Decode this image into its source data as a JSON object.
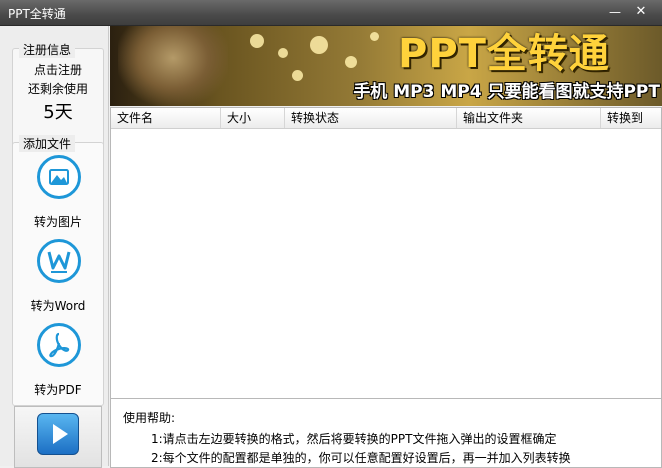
{
  "window": {
    "title": "PPT全转通",
    "minimize": "—",
    "close": "✕"
  },
  "sidebar": {
    "register": {
      "group_title": "注册信息",
      "click_register": "点击注册",
      "remaining_label": "还剩余使用",
      "remaining_days": "5天"
    },
    "add_files": {
      "group_title": "添加文件",
      "items": [
        {
          "label": "转为图片",
          "icon": "image-icon"
        },
        {
          "label": "转为Word",
          "icon": "word-icon"
        },
        {
          "label": "转为PDF",
          "icon": "pdf-icon"
        }
      ]
    },
    "start_icon": "play-icon"
  },
  "banner": {
    "title": "PPT全转通",
    "subtitle": "手机 MP3 MP4 只要能看图就支持PPT"
  },
  "table": {
    "columns": [
      "文件名",
      "大小",
      "转换状态",
      "输出文件夹",
      "转换到"
    ],
    "rows": []
  },
  "help": {
    "title": "使用帮助:",
    "lines": [
      "1:请点击左边要转换的格式，然后将要转换的PPT文件拖入弹出的设置框确定",
      "2:每个文件的配置都是单独的，你可以任意配置好设置后，再一并加入列表转换"
    ]
  },
  "colors": {
    "accent": "#1e97d8",
    "banner_title": "#ffd23b"
  }
}
